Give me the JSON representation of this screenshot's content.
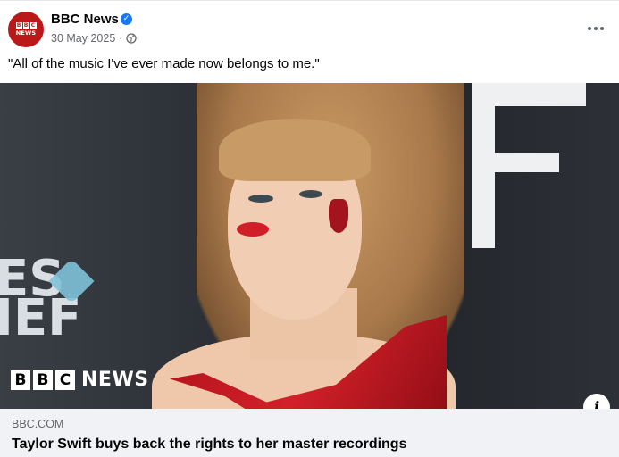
{
  "post": {
    "page_name": "BBC News",
    "verified": true,
    "date": "30 May 2025",
    "separator": "·",
    "audience_icon": "globe-icon",
    "more_icon": "more-options-icon",
    "text": "\"All of the music I've ever made now belongs to me.\""
  },
  "avatar": {
    "letters": [
      "B",
      "B",
      "C"
    ],
    "sub": "NEWS"
  },
  "image": {
    "watermark_letters": [
      "B",
      "B",
      "C"
    ],
    "watermark_word": "NEWS",
    "background_text": "ES\nIEF",
    "info_label": "i"
  },
  "link": {
    "domain": "BBC.COM",
    "title": "Taylor Swift buys back the rights to her master recordings"
  },
  "colors": {
    "brand_red": "#bb1919",
    "verified_blue": "#1877f2",
    "muted_text": "#65676b",
    "footer_bg": "#f0f2f5"
  }
}
